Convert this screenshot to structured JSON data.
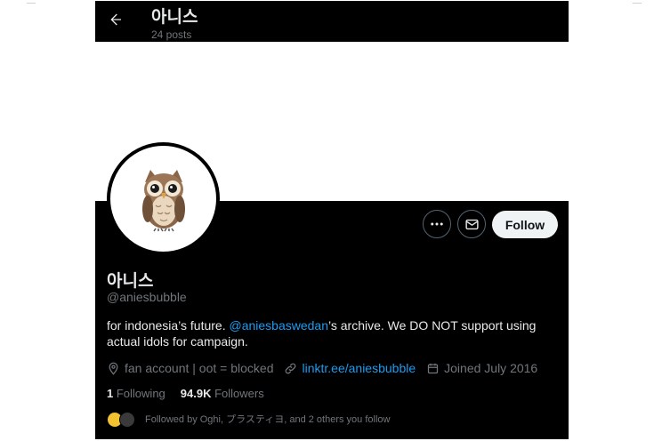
{
  "header": {
    "title": "아니스",
    "subtitle": "24 posts"
  },
  "profile": {
    "display_name": "아니스",
    "handle": "@aniesbubble",
    "bio": {
      "before": "for indonesia’s future. ",
      "mention": "@aniesbaswedan",
      "after": "’s archive. We DO NOT support using actual idols for campaign."
    },
    "location": "fan account | oot = blocked",
    "link": "linktr.ee/aniesbubble",
    "joined": "Joined July 2016",
    "following_count": "1",
    "following_label": "Following",
    "followers_count": "94.9K",
    "followers_label": "Followers",
    "followed_by": "Followed by Oghi, プラスティヨ, and 2 others you follow"
  },
  "actions": {
    "follow_label": "Follow"
  },
  "icons": {
    "back": "arrow-left-icon",
    "more": "more-horizontal-icon",
    "message": "envelope-icon",
    "location": "location-pin-icon",
    "link": "link-icon",
    "calendar": "calendar-icon",
    "avatar": "owl-emoji"
  },
  "colors": {
    "background": "#000000",
    "text": "#e7e9ea",
    "muted": "#71767b",
    "accent": "#1d9bf0",
    "follow_button": "#eff3f4"
  }
}
